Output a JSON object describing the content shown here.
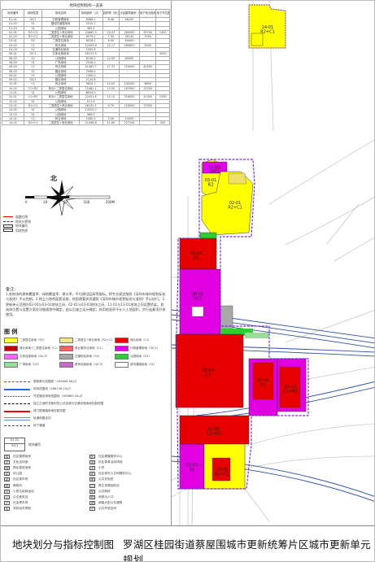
{
  "footer": {
    "left_title": "地块划分与指标控制图",
    "right_title": "罗湖区桂园街道蔡屋围城市更新统筹片区城市更新单元规划"
  },
  "index_table": {
    "title": "地块控制指标一览表",
    "headers": [
      "地块编号",
      "用地性质",
      "用地名称",
      "用地面积（㎡）",
      "容积率（地上）",
      "计容建筑面积（㎡）",
      "地下商业面积（㎡）",
      "地下车位配建（个）"
    ],
    "rows": [
      [
        "01-01",
        "GIC1",
        "行政管理用地",
        "8466.1",
        "6.46",
        "66200",
        "",
        ""
      ],
      [
        "01-02",
        "S1",
        "路径的道路用地",
        "2915.7",
        "",
        "",
        "",
        ""
      ],
      [
        "01-03",
        "S1",
        "公园绿地",
        "465.2",
        "",
        "",
        "",
        ""
      ],
      [
        "02-01",
        "R2+C1",
        "二类居住+商业用地",
        "24660.5",
        "10.47",
        "260000",
        "39700",
        "1300"
      ],
      [
        "02-02",
        "R2+C1",
        "二类居住+商业用地",
        "6579.2",
        "7.00",
        "36144",
        "7000",
        ""
      ],
      [
        "03-01",
        "R2",
        "二类居住用地",
        "8026.1",
        "8.00",
        "64400",
        "",
        ""
      ],
      [
        "03-02",
        "C1",
        "商业用地",
        "12003.8",
        "22.17",
        "265800",
        "5400",
        ""
      ],
      [
        "03-03",
        "S1",
        "交通场站用地",
        "1200.8",
        "",
        "",
        "",
        ""
      ],
      [
        "08-01",
        "GIC1",
        "文体设施用地",
        "26127.9",
        "",
        "",
        "",
        "4000"
      ],
      [
        "08-02",
        "G1",
        "公园绿地",
        "8136.2",
        "12.63",
        "80000",
        "",
        ""
      ],
      [
        "08-03",
        "S1",
        "广场用地",
        "2526.0",
        "",
        "",
        "",
        ""
      ],
      [
        "08-04",
        "C1",
        "商业用地",
        "41462.7",
        "17.37",
        "720000",
        "40000",
        ""
      ],
      [
        "08-05",
        "S1",
        "路径用地",
        "2566.0",
        "",
        "",
        "",
        ""
      ],
      [
        "09-01",
        "G1",
        "公园绿地",
        "1300.0",
        "",
        "",
        "",
        ""
      ],
      [
        "09-02",
        "GIC1",
        "路径用地",
        "2120.8",
        "",
        "",
        "",
        ""
      ],
      [
        "10-01",
        "C1",
        "商业用地",
        "9826.7",
        "14.00",
        "140200",
        "6600",
        ""
      ],
      [
        "10-02",
        "C1+R2",
        "商业+二类居住用地",
        "12481.1",
        "13.50",
        "167900",
        "15200",
        ""
      ],
      [
        "11-01",
        "S1",
        "公园绿地",
        "6814.0",
        "",
        "",
        "",
        ""
      ],
      [
        "12-01",
        "C1+R2",
        "商业+二类居住用地",
        "22451.8",
        "14.12",
        "316000",
        "31000",
        "1500"
      ],
      [
        "12-02",
        "S1",
        "公园绿地",
        "917.6",
        "",
        "",
        "",
        ""
      ],
      [
        "13-01",
        "R2+C1",
        "二类居住+商业用地",
        "26135.1",
        "6.70",
        "229000",
        "17000",
        ""
      ],
      [
        "13-02",
        "S1",
        "公园绿地",
        "13325.0",
        "",
        "",
        "",
        ""
      ],
      [
        "13-03",
        "S1",
        "公园绿地",
        "986.0",
        "",
        "",
        "",
        ""
      ],
      [
        "14-01",
        "C1",
        "商业用地",
        "1080.0",
        "5.00",
        "14000",
        "",
        ""
      ],
      [
        "14-02",
        "R2+C1",
        "二类居住+商业用地",
        "21496.8",
        "11.60",
        "227144",
        "",
        "900"
      ]
    ]
  },
  "north_label": "北",
  "scale_labels": [
    "0",
    "20",
    "50",
    "100",
    "200M"
  ],
  "small_legend": [
    "道路红线",
    "地块分界线",
    "地块编号",
    "用地性质"
  ],
  "notes": {
    "title": "备注：",
    "text": "1.各地块的建筑覆盖率、绿地覆盖率、建水率、平均建设层高等指标，将专业规定按照《深圳市城市规划标准与准则》予以控制。2.独立占地的配套设施，其配建要求须遵照《深圳市城市规划标准与准则》予以执行。3.更新单元范围内02-01与03-01地块之间、02-01与03-03地块之间、11-01与13-01地块之间设置桥梁。其具体位置与设置方案在详细规划中确定，由以后施工设计确定，其用地面积不计入土地面积，步行连廊须开放使用。"
  },
  "legend": {
    "title": "图  例",
    "items": [
      {
        "label": "二类居住用地（R2）",
        "color": "#ffff33"
      },
      {
        "label": "二类居住+商业用地（R2+C1）",
        "color": "#f2e68c"
      },
      {
        "label": "商业用地（C1）",
        "color": "#e60000"
      },
      {
        "label": "商业用地+二类居住用地（C1+R2）",
        "color": "#c00000"
      },
      {
        "label": "商业服务业用地（C1）",
        "color": "#ff6060"
      },
      {
        "label": "行政管理用地（GIC1）",
        "color": "#e100e1"
      },
      {
        "label": "文体设施用地（GIC2）",
        "color": "#ff66ff"
      },
      {
        "label": "交通场站用地（S4）",
        "color": "#a8a8a8"
      },
      {
        "label": "公园绿地（G1）",
        "color": "#33cc33"
      },
      {
        "label": "广场用地（G3）",
        "color": "#99dd99"
      },
      {
        "label": "教育设施用地（GIC3）",
        "color": "#cc66cc"
      },
      {
        "label": "城市道路用地（S1）",
        "color": "#ffffff"
      }
    ],
    "lines": [
      {
        "label": "更新单元范围线（108458.06㎡）",
        "color": "#7a2fd8",
        "style": "dashed"
      },
      {
        "label": "拆除范围线（286726.19㎡）",
        "color": "#1b6fe8",
        "style": "solid"
      },
      {
        "label": "开发建设用地范围线（189685.34㎡）",
        "color": "#333333",
        "style": "dotted"
      },
      {
        "label": "独立占地的非营利性公共设施与交通设施用地控制范围",
        "color": "#000000",
        "style": "dashdot"
      },
      {
        "label": "城门楼道路用地控制范围",
        "color": "#ff0000",
        "style": "solid"
      },
      {
        "label": "轨道线路走向",
        "color": "#5a8cd8",
        "style": "double"
      },
      {
        "label": "地下通道",
        "color": "#444444",
        "style": "dashed"
      }
    ],
    "code_box": {
      "row1": "01-01",
      "row2": "GIC1",
      "row3": "地块编号"
    },
    "icons": [
      {
        "label": "社区管理用房",
        "glyph": "管"
      },
      {
        "label": "社区健康服务中心",
        "glyph": "医"
      },
      {
        "label": "文化活动室",
        "glyph": "文"
      },
      {
        "label": "社区体育活动场地",
        "glyph": "体"
      },
      {
        "label": "物业服务用房",
        "glyph": "物"
      },
      {
        "label": "小学",
        "glyph": "学"
      },
      {
        "label": "幼儿园",
        "glyph": "幼"
      },
      {
        "label": "社区老年人日间照料中心",
        "glyph": "老"
      },
      {
        "label": "社区菜市场",
        "glyph": "菜"
      },
      {
        "label": "公共充电桩",
        "glyph": "电"
      },
      {
        "label": "邮政所",
        "glyph": "邮"
      },
      {
        "label": "再生资源回收站",
        "glyph": "回"
      },
      {
        "label": "小型垃圾转运站",
        "glyph": "垃"
      },
      {
        "label": "公共厕所",
        "glyph": "厕"
      },
      {
        "label": "公交首末站",
        "glyph": "公"
      },
      {
        "label": "地铁出入口",
        "glyph": "铁"
      },
      {
        "label": "社会停车场",
        "glyph": "P"
      },
      {
        "label": "新建大型公共建筑",
        "glyph": "建"
      },
      {
        "label": "非机动车停放",
        "glyph": "车"
      },
      {
        "label": "公共开放空间",
        "glyph": "空"
      }
    ]
  },
  "map_labels": {
    "parcels": [
      {
        "code": "14-01",
        "use": "R2+C1"
      },
      {
        "code": "01-01",
        "use": "GIC1"
      },
      {
        "code": "02-01",
        "use": "R2+C1"
      },
      {
        "code": "03-01",
        "use": "R2"
      },
      {
        "code": "03-02",
        "use": "C1"
      },
      {
        "code": "08-01",
        "use": "GIC1"
      },
      {
        "code": "08-04",
        "use": "C1"
      },
      {
        "code": "10-01",
        "use": "C1"
      },
      {
        "code": "10-02",
        "use": "C1+R2"
      },
      {
        "code": "12-01",
        "use": "C1+R2"
      },
      {
        "code": "13-01",
        "use": "R2+C1"
      },
      {
        "code": "11-01",
        "use": "S1"
      }
    ]
  }
}
